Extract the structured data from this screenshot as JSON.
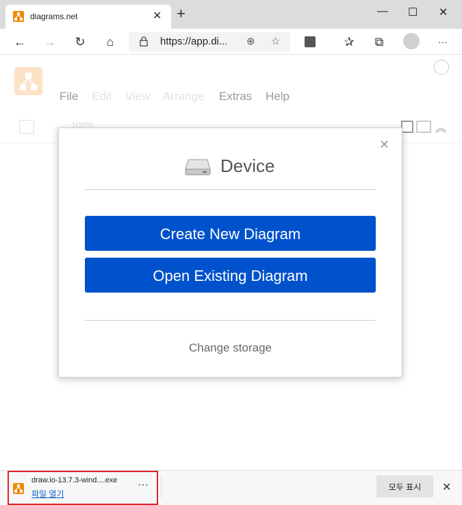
{
  "tab": {
    "title": "diagrams.net",
    "close": "✕"
  },
  "newtab": "+",
  "window": {
    "minimize": "—",
    "maximize": "☐",
    "close": "✕"
  },
  "toolbar": {
    "back": "←",
    "forward": "→",
    "refresh": "↻",
    "home": "⌂",
    "url": "https://app.di...",
    "add": "⊕",
    "favorite": "☆",
    "favorites": "✰",
    "collections": "⧉",
    "more": "···"
  },
  "app": {
    "menus": [
      {
        "label": "File",
        "enabled": true
      },
      {
        "label": "Edit",
        "enabled": false
      },
      {
        "label": "View",
        "enabled": false
      },
      {
        "label": "Arrange",
        "enabled": false
      },
      {
        "label": "Extras",
        "enabled": true
      },
      {
        "label": "Help",
        "enabled": true
      }
    ],
    "zoom_ghost": "100%"
  },
  "dialog": {
    "title": "Device",
    "close": "✕",
    "create_label": "Create New Diagram",
    "open_label": "Open Existing Diagram",
    "change_storage": "Change storage"
  },
  "download": {
    "filename": "draw.io-13.7.3-wind....exe",
    "open_link": "파일 열기",
    "more": "···",
    "show_all": "모두 표시",
    "close": "✕"
  },
  "colors": {
    "brand": "#f08705",
    "primary_button": "#0052cc",
    "highlight": "#e0232b"
  }
}
